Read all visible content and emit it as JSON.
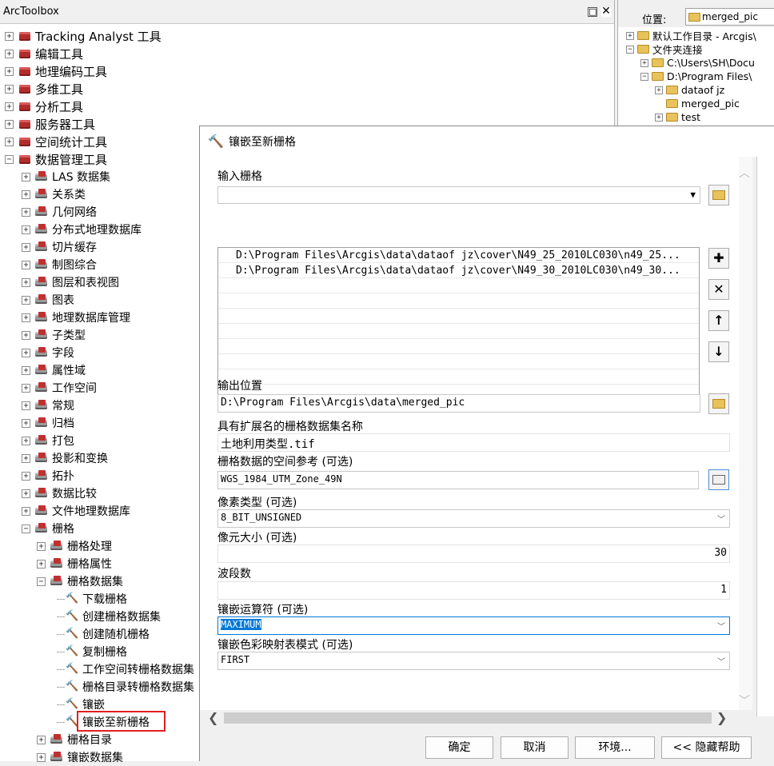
{
  "toolbox": {
    "title": "ArcToolbox",
    "items": [
      {
        "label": "Tracking Analyst 工具",
        "level": 0,
        "expanded": false,
        "kind": "toolbox"
      },
      {
        "label": "编辑工具",
        "level": 0,
        "expanded": false,
        "kind": "toolbox"
      },
      {
        "label": "地理编码工具",
        "level": 0,
        "expanded": false,
        "kind": "toolbox"
      },
      {
        "label": "多维工具",
        "level": 0,
        "expanded": false,
        "kind": "toolbox"
      },
      {
        "label": "分析工具",
        "level": 0,
        "expanded": false,
        "kind": "toolbox"
      },
      {
        "label": "服务器工具",
        "level": 0,
        "expanded": false,
        "kind": "toolbox"
      },
      {
        "label": "空间统计工具",
        "level": 0,
        "expanded": false,
        "kind": "toolbox"
      },
      {
        "label": "数据管理工具",
        "level": 0,
        "expanded": true,
        "kind": "toolbox"
      },
      {
        "label": "LAS 数据集",
        "level": 1,
        "expanded": false,
        "kind": "toolset"
      },
      {
        "label": "关系类",
        "level": 1,
        "expanded": false,
        "kind": "toolset"
      },
      {
        "label": "几何网络",
        "level": 1,
        "expanded": false,
        "kind": "toolset"
      },
      {
        "label": "分布式地理数据库",
        "level": 1,
        "expanded": false,
        "kind": "toolset"
      },
      {
        "label": "切片缓存",
        "level": 1,
        "expanded": false,
        "kind": "toolset"
      },
      {
        "label": "制图综合",
        "level": 1,
        "expanded": false,
        "kind": "toolset"
      },
      {
        "label": "图层和表视图",
        "level": 1,
        "expanded": false,
        "kind": "toolset"
      },
      {
        "label": "图表",
        "level": 1,
        "expanded": false,
        "kind": "toolset"
      },
      {
        "label": "地理数据库管理",
        "level": 1,
        "expanded": false,
        "kind": "toolset"
      },
      {
        "label": "子类型",
        "level": 1,
        "expanded": false,
        "kind": "toolset"
      },
      {
        "label": "字段",
        "level": 1,
        "expanded": false,
        "kind": "toolset"
      },
      {
        "label": "属性域",
        "level": 1,
        "expanded": false,
        "kind": "toolset"
      },
      {
        "label": "工作空间",
        "level": 1,
        "expanded": false,
        "kind": "toolset"
      },
      {
        "label": "常规",
        "level": 1,
        "expanded": false,
        "kind": "toolset"
      },
      {
        "label": "归档",
        "level": 1,
        "expanded": false,
        "kind": "toolset"
      },
      {
        "label": "打包",
        "level": 1,
        "expanded": false,
        "kind": "toolset"
      },
      {
        "label": "投影和变换",
        "level": 1,
        "expanded": false,
        "kind": "toolset"
      },
      {
        "label": "拓扑",
        "level": 1,
        "expanded": false,
        "kind": "toolset"
      },
      {
        "label": "数据比较",
        "level": 1,
        "expanded": false,
        "kind": "toolset"
      },
      {
        "label": "文件地理数据库",
        "level": 1,
        "expanded": false,
        "kind": "toolset"
      },
      {
        "label": "栅格",
        "level": 1,
        "expanded": true,
        "kind": "toolset"
      },
      {
        "label": "栅格处理",
        "level": 2,
        "expanded": false,
        "kind": "toolset"
      },
      {
        "label": "栅格属性",
        "level": 2,
        "expanded": false,
        "kind": "toolset"
      },
      {
        "label": "栅格数据集",
        "level": 2,
        "expanded": true,
        "kind": "toolset"
      },
      {
        "label": "下载栅格",
        "level": 3,
        "kind": "tool"
      },
      {
        "label": "创建栅格数据集",
        "level": 3,
        "kind": "tool"
      },
      {
        "label": "创建随机栅格",
        "level": 3,
        "kind": "tool"
      },
      {
        "label": "复制栅格",
        "level": 3,
        "kind": "tool"
      },
      {
        "label": "工作空间转栅格数据集",
        "level": 3,
        "kind": "tool"
      },
      {
        "label": "栅格目录转栅格数据集",
        "level": 3,
        "kind": "tool"
      },
      {
        "label": "镶嵌",
        "level": 3,
        "kind": "tool"
      },
      {
        "label": "镶嵌至新栅格",
        "level": 3,
        "kind": "tool",
        "highlighted": true
      },
      {
        "label": "栅格目录",
        "level": 2,
        "expanded": false,
        "kind": "toolset"
      },
      {
        "label": "镶嵌数据集",
        "level": 2,
        "expanded": false,
        "kind": "toolset"
      }
    ]
  },
  "catalog": {
    "location_label": "位置:",
    "location_value": "merged_pic",
    "items": [
      {
        "label": "默认工作目录 - Arcgis\\",
        "level": 0,
        "expander": "+"
      },
      {
        "label": "文件夹连接",
        "level": 0,
        "expander": "-"
      },
      {
        "label": "C:\\Users\\SH\\Docu",
        "level": 1,
        "expander": "+"
      },
      {
        "label": "D:\\Program Files\\",
        "level": 1,
        "expander": "-"
      },
      {
        "label": "dataof jz",
        "level": 2,
        "expander": "+"
      },
      {
        "label": "merged_pic",
        "level": 2,
        "expander": ""
      },
      {
        "label": "test",
        "level": 2,
        "expander": "+"
      }
    ]
  },
  "dialog": {
    "title": "镶嵌至新栅格",
    "input_rasters_label": "输入栅格",
    "input_rasters": [
      "D:\\Program Files\\Arcgis\\data\\dataof jz\\cover\\N49_25_2010LC030\\n49_25...",
      "D:\\Program Files\\Arcgis\\data\\dataof jz\\cover\\N49_30_2010LC030\\n49_30..."
    ],
    "output_location_label": "输出位置",
    "output_location": "D:\\Program Files\\Arcgis\\data\\merged_pic",
    "dataset_name_label": "具有扩展名的栅格数据集名称",
    "dataset_name": "土地利用类型.tif",
    "spatial_ref_label": "栅格数据的空间参考 (可选)",
    "spatial_ref": "WGS_1984_UTM_Zone_49N",
    "pixel_type_label": "像素类型 (可选)",
    "pixel_type": "8_BIT_UNSIGNED",
    "cellsize_label": "像元大小 (可选)",
    "cellsize": "30",
    "bands_label": "波段数",
    "bands": "1",
    "mosaic_operator_label": "镶嵌运算符 (可选)",
    "mosaic_operator": "MAXIMUM",
    "colormap_mode_label": "镶嵌色彩映射表模式 (可选)",
    "colormap_mode": "FIRST",
    "buttons": {
      "ok": "确定",
      "cancel": "取消",
      "environments": "环境...",
      "hide_help": "<< 隐藏帮助"
    }
  }
}
